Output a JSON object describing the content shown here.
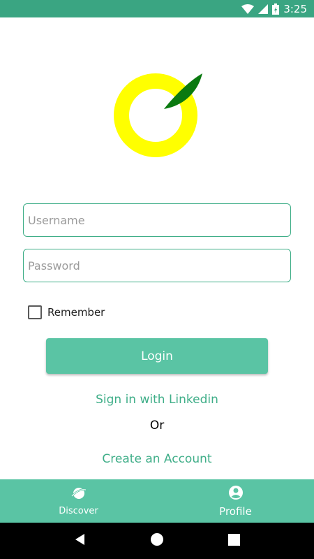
{
  "status_bar": {
    "time": "3:25",
    "icons": [
      "wifi-icon",
      "cell-signal-icon",
      "battery-charging-icon"
    ]
  },
  "colors": {
    "status_bar": "#3aa582",
    "accent": "#5ac4a4",
    "link": "#3fae88",
    "logo_ring": "#ffff00",
    "logo_leaf": "#0a7a10"
  },
  "logo": {
    "icon": "orange-logo-icon"
  },
  "form": {
    "username_placeholder": "Username",
    "password_placeholder": "Password",
    "remember_label": "Remember",
    "remember_checked": false,
    "login_label": "Login"
  },
  "links": {
    "linkedin": "Sign in with Linkedin",
    "or": "Or",
    "create_account": "Create an Account"
  },
  "bottom_nav": {
    "items": [
      {
        "label": "Discover",
        "icon": "planet-icon"
      },
      {
        "label": "Profile",
        "icon": "account-circle-icon"
      }
    ]
  },
  "system_nav": {
    "icons": [
      "back-icon",
      "home-icon",
      "recents-icon"
    ]
  }
}
